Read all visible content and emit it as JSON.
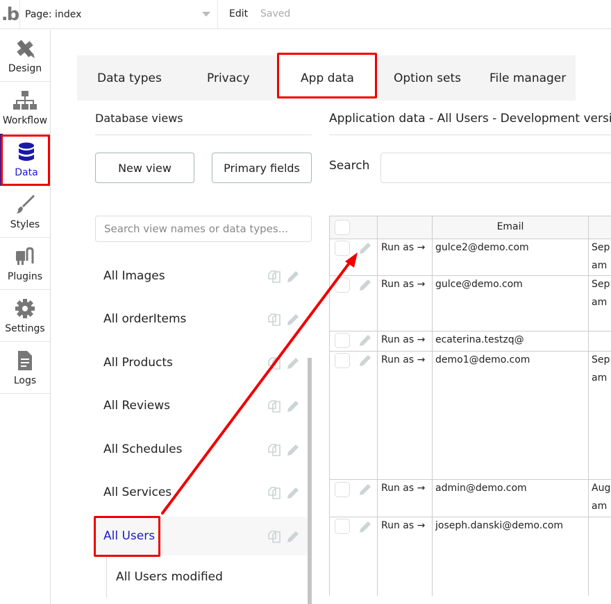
{
  "topbar": {
    "logo": ".b",
    "page_selector": "Page: index",
    "edit": "Edit",
    "status": "Saved"
  },
  "nav": {
    "items": [
      {
        "label": "Design",
        "icon": "design-icon"
      },
      {
        "label": "Workflow",
        "icon": "workflow-icon"
      },
      {
        "label": "Data",
        "icon": "database-icon",
        "active": true
      },
      {
        "label": "Styles",
        "icon": "brush-icon"
      },
      {
        "label": "Plugins",
        "icon": "plug-icon"
      },
      {
        "label": "Settings",
        "icon": "gear-icon"
      },
      {
        "label": "Logs",
        "icon": "document-icon"
      }
    ]
  },
  "tabs": [
    {
      "label": "Data types"
    },
    {
      "label": "Privacy"
    },
    {
      "label": "App data",
      "active": true
    },
    {
      "label": "Option sets"
    },
    {
      "label": "File manager"
    }
  ],
  "views_panel": {
    "title": "Database views",
    "new_view": "New view",
    "primary_fields": "Primary fields",
    "search_placeholder": "Search view names or data types...",
    "items": [
      {
        "label": "All Images"
      },
      {
        "label": "All orderItems"
      },
      {
        "label": "All Products"
      },
      {
        "label": "All Reviews"
      },
      {
        "label": "All Schedules"
      },
      {
        "label": "All Services"
      },
      {
        "label": "All Users",
        "selected": true
      }
    ],
    "sub_items": [
      {
        "label": "All Users modified"
      }
    ]
  },
  "data_panel": {
    "title": "Application data - All Users - Development version",
    "search_label": "Search",
    "search_value": "",
    "columns": [
      "",
      "",
      "Email",
      ""
    ],
    "rows": [
      {
        "run_as": "Run as →",
        "email": "gulce2@demo.com",
        "date_line1": "Sep",
        "date_line2": "am"
      },
      {
        "run_as": "Run as →",
        "email": "gulce@demo.com",
        "date_line1": "Sep",
        "date_line2": "am"
      },
      {
        "run_as": "Run as →",
        "email": "ecaterina.testzq@",
        "date_line1": "",
        "date_line2": ""
      },
      {
        "run_as": "Run as →",
        "email": "demo1@demo.com",
        "date_line1": "Sep",
        "date_line2": "am"
      },
      {
        "run_as": "Run as →",
        "email": "admin@demo.com",
        "date_line1": "Aug",
        "date_line2": "am"
      },
      {
        "run_as": "Run as →",
        "email": "joseph.danski@demo.com",
        "date_line1": "",
        "date_line2": ""
      }
    ]
  },
  "annotations": {
    "highlight_color": "#ee0000",
    "active_color": "#1a1acc"
  }
}
